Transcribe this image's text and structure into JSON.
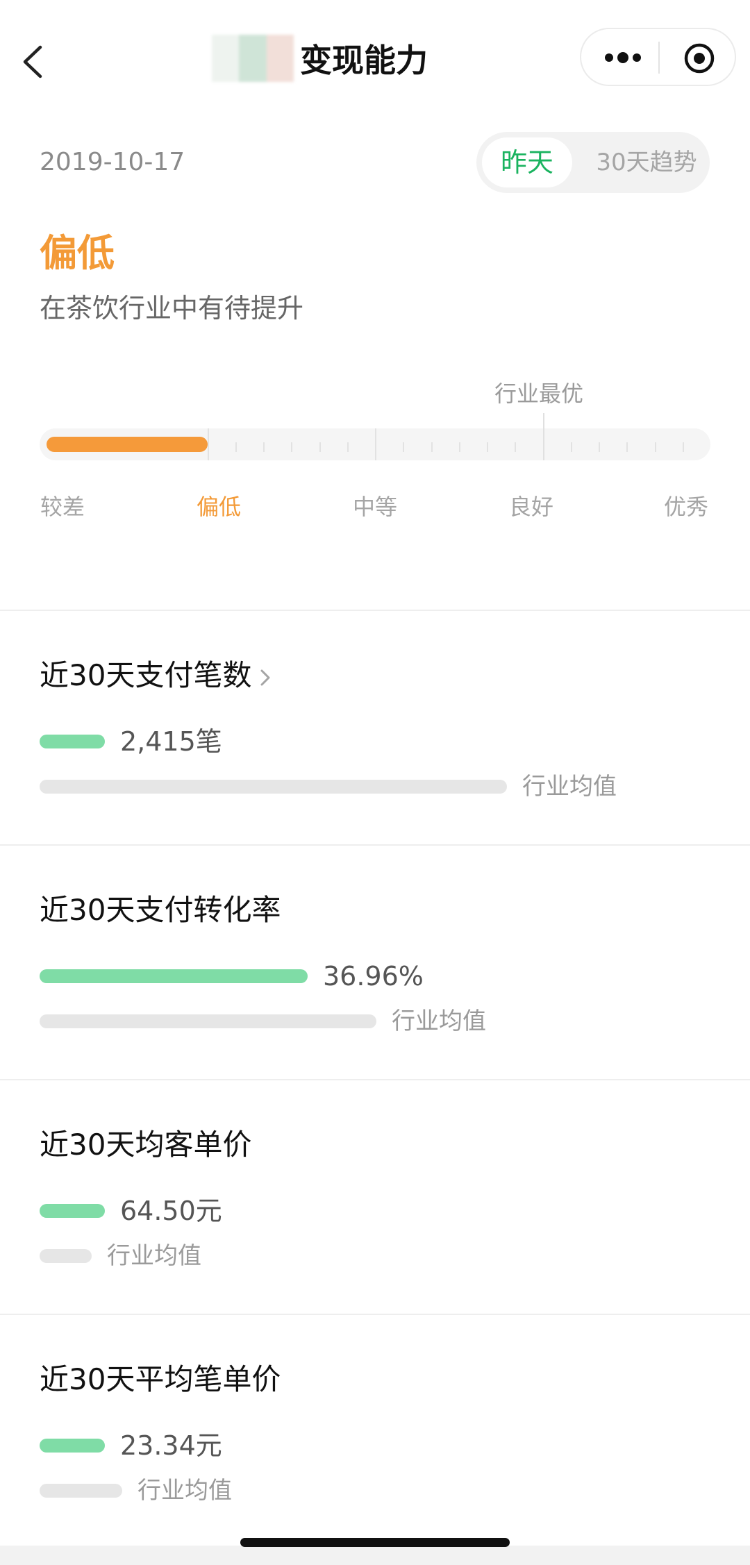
{
  "header": {
    "title": "变现能力",
    "avatar_colors": [
      "#eef3ef",
      "#cfe4d7",
      "#f2dfd9"
    ]
  },
  "date": "2019-10-17",
  "toggle": {
    "active": "昨天",
    "inactive": "30天趋势"
  },
  "level": {
    "label": "偏低",
    "desc": "在茶饮行业中有待提升",
    "best_label": "行业最优",
    "progress_fraction": 0.25,
    "best_position_fraction": 0.74,
    "scale": [
      "较差",
      "偏低",
      "中等",
      "良好",
      "优秀"
    ],
    "active_index": 1
  },
  "metrics": [
    {
      "title": "近30天支付笔数",
      "value": "2,415笔",
      "avg_label": "行业均值",
      "self_fraction": 0.095,
      "avg_fraction": 0.68,
      "has_link": true
    },
    {
      "title": "近30天支付转化率",
      "value": "36.96%",
      "avg_label": "行业均值",
      "self_fraction": 0.39,
      "avg_fraction": 0.49,
      "has_link": false
    },
    {
      "title": "近30天均客单价",
      "value": "64.50元",
      "avg_label": "行业均值",
      "self_fraction": 0.095,
      "avg_fraction": 0.076,
      "has_link": false
    },
    {
      "title": "近30天平均笔单价",
      "value": "23.34元",
      "avg_label": "行业均值",
      "self_fraction": 0.095,
      "avg_fraction": 0.12,
      "has_link": false
    }
  ],
  "colors": {
    "accent_orange": "#f59a3a",
    "accent_green": "#1ab35f",
    "bar_green": "#7fdca6",
    "bar_gray": "#e6e6e6"
  }
}
